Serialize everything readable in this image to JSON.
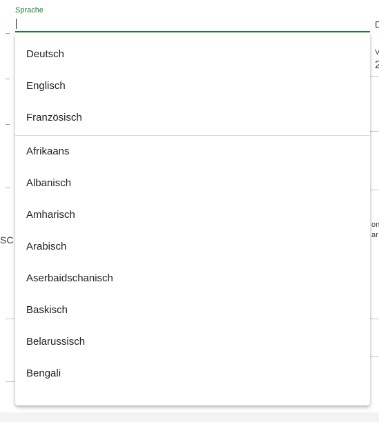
{
  "language_field": {
    "label": "Sprache",
    "value": ""
  },
  "background_fragments": {
    "right_col_1": "D",
    "right_col_2": "V",
    "right_col_3": "2",
    "left_col_1": "SC",
    "right_col_4": "on",
    "right_col_5": "ar"
  },
  "language_options": {
    "pinned": [
      "Deutsch",
      "Englisch",
      "Französisch"
    ],
    "all": [
      "Afrikaans",
      "Albanisch",
      "Amharisch",
      "Arabisch",
      "Aserbaidschanisch",
      "Baskisch",
      "Belarussisch",
      "Bengali"
    ]
  },
  "colors": {
    "accent_green": "#188038",
    "divider": "#dadce0"
  }
}
